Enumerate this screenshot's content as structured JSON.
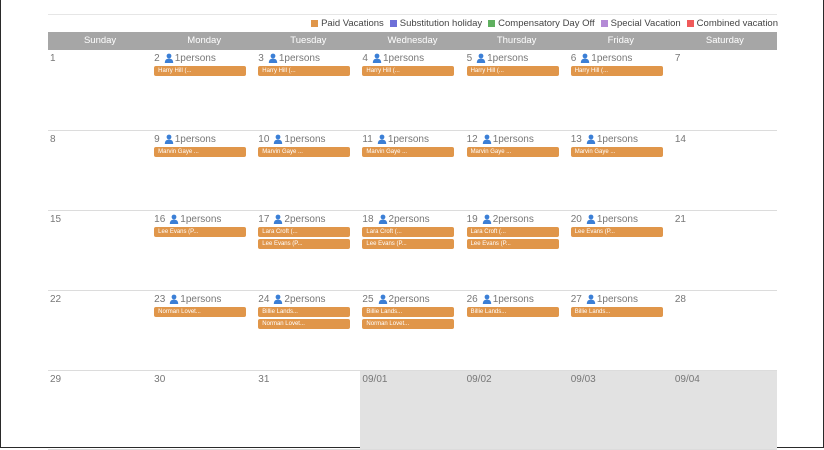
{
  "legend": [
    {
      "label": "Paid Vacations",
      "color": "#e0964a"
    },
    {
      "label": "Substitution holiday",
      "color": "#6d6fd8"
    },
    {
      "label": "Compensatory Day Off",
      "color": "#5fb05f"
    },
    {
      "label": "Special Vacation",
      "color": "#b48ad6"
    },
    {
      "label": "Combined vacation",
      "color": "#f05a5a"
    }
  ],
  "weekdays": [
    "Sunday",
    "Monday",
    "Tuesday",
    "Wednesday",
    "Thursday",
    "Friday",
    "Saturday"
  ],
  "weeks": [
    [
      {
        "date": "1",
        "persons": "",
        "events": []
      },
      {
        "date": "2",
        "persons": "1persons",
        "events": [
          "Harry Hill (..."
        ]
      },
      {
        "date": "3",
        "persons": "1persons",
        "events": [
          "Harry Hill (..."
        ]
      },
      {
        "date": "4",
        "persons": "1persons",
        "events": [
          "Harry Hill (..."
        ]
      },
      {
        "date": "5",
        "persons": "1persons",
        "events": [
          "Harry Hill (..."
        ]
      },
      {
        "date": "6",
        "persons": "1persons",
        "events": [
          "Harry Hill (..."
        ]
      },
      {
        "date": "7",
        "persons": "",
        "events": []
      }
    ],
    [
      {
        "date": "8",
        "persons": "",
        "events": []
      },
      {
        "date": "9",
        "persons": "1persons",
        "events": [
          "Marvin Gaye ..."
        ]
      },
      {
        "date": "10",
        "persons": "1persons",
        "events": [
          "Marvin Gaye ..."
        ]
      },
      {
        "date": "11",
        "persons": "1persons",
        "events": [
          "Marvin Gaye ..."
        ]
      },
      {
        "date": "12",
        "persons": "1persons",
        "events": [
          "Marvin Gaye ..."
        ]
      },
      {
        "date": "13",
        "persons": "1persons",
        "events": [
          "Marvin Gaye ..."
        ]
      },
      {
        "date": "14",
        "persons": "",
        "events": []
      }
    ],
    [
      {
        "date": "15",
        "persons": "",
        "events": []
      },
      {
        "date": "16",
        "persons": "1persons",
        "events": [
          "Lee Evans (P..."
        ]
      },
      {
        "date": "17",
        "persons": "2persons",
        "events": [
          "Lara Croft (...",
          "Lee Evans (P..."
        ]
      },
      {
        "date": "18",
        "persons": "2persons",
        "events": [
          "Lara Croft (...",
          "Lee Evans (P..."
        ]
      },
      {
        "date": "19",
        "persons": "2persons",
        "events": [
          "Lara Croft (...",
          "Lee Evans (P..."
        ]
      },
      {
        "date": "20",
        "persons": "1persons",
        "events": [
          "Lee Evans (P..."
        ]
      },
      {
        "date": "21",
        "persons": "",
        "events": []
      }
    ],
    [
      {
        "date": "22",
        "persons": "",
        "events": []
      },
      {
        "date": "23",
        "persons": "1persons",
        "events": [
          "Norman Lovet..."
        ]
      },
      {
        "date": "24",
        "persons": "2persons",
        "events": [
          "Billie Lands...",
          "Norman Lovet..."
        ]
      },
      {
        "date": "25",
        "persons": "2persons",
        "events": [
          "Billie Lands...",
          "Norman Lovet..."
        ]
      },
      {
        "date": "26",
        "persons": "1persons",
        "events": [
          "Billie Lands..."
        ]
      },
      {
        "date": "27",
        "persons": "1persons",
        "events": [
          "Billie Lands..."
        ]
      },
      {
        "date": "28",
        "persons": "",
        "events": []
      }
    ],
    [
      {
        "date": "29",
        "persons": "",
        "events": [],
        "greyed": false
      },
      {
        "date": "30",
        "persons": "",
        "events": [],
        "greyed": false
      },
      {
        "date": "31",
        "persons": "",
        "events": [],
        "greyed": false
      },
      {
        "date": "09/01",
        "persons": "",
        "events": [],
        "greyed": true
      },
      {
        "date": "09/02",
        "persons": "",
        "events": [],
        "greyed": true
      },
      {
        "date": "09/03",
        "persons": "",
        "events": [],
        "greyed": true
      },
      {
        "date": "09/04",
        "persons": "",
        "events": [],
        "greyed": true
      }
    ]
  ]
}
